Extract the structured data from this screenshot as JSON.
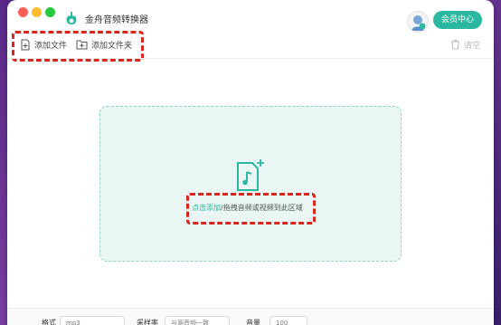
{
  "window": {
    "title": "金舟音频转换器",
    "vip_button_label": "会员中心"
  },
  "toolbar": {
    "add_file_label": "添加文件",
    "add_folder_label": "添加文件夹",
    "clear_label": "清空"
  },
  "dropzone": {
    "link_text": "点击添加",
    "hint_text": "/拖拽音频或视频到此区域"
  },
  "bottom_bar": {
    "format_label": "格式",
    "format_value": "mp3",
    "sample_rate_label": "采样率",
    "sample_rate_value": "与源音频一致",
    "volume_label": "音量",
    "volume_value": "100"
  },
  "colors": {
    "accent": "#2bb8a0",
    "dropzone_bg": "#e9f6f4",
    "highlight": "#d7261c"
  },
  "icons": [
    "app-logo-icon",
    "avatar-icon",
    "add-file-icon",
    "add-folder-icon",
    "trash-icon",
    "music-file-icon"
  ]
}
